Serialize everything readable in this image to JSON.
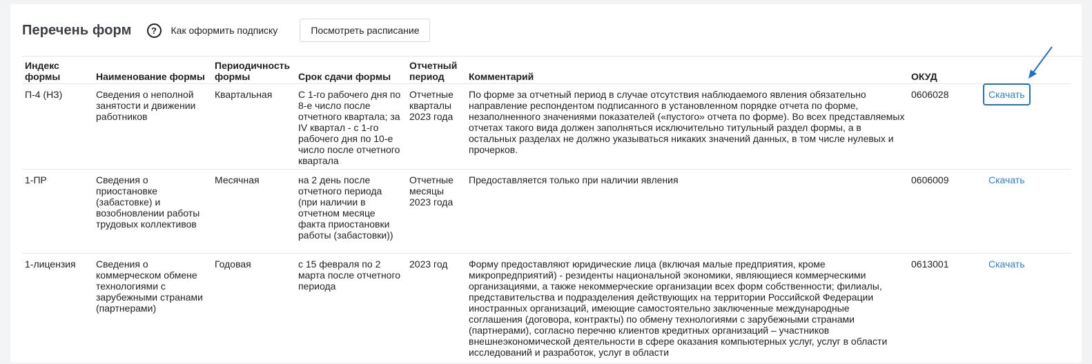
{
  "header": {
    "title": "Перечень форм",
    "help_link": "Как оформить подписку",
    "schedule_button": "Посмотреть расписание"
  },
  "table": {
    "columns": [
      "Индекс формы",
      "Наименование формы",
      "Периодичность формы",
      "Срок сдачи формы",
      "Отчетный период",
      "Комментарий",
      "ОКУД",
      ""
    ],
    "rows": [
      {
        "index": "П-4 (НЗ)",
        "name": "Сведения о неполной занятости и движении работников",
        "periodicity": "Квартальная",
        "deadline": "С 1-го рабочего дня по 8-е число после отчетного квартала; за IV квартал - с 1-го рабочего дня по 10-е число после отчетного квартала",
        "report_period": "Отчетные кварталы 2023 года",
        "comment": "По форме за отчетный период в случае отсутствия наблюдаемого явления обязательно направление респондентом подписанного в установленном порядке отчета по форме, незаполненного значениями показателей («пустого» отчета по форме). Во всех представляемых отчетах такого вида должен заполняться исключительно титульный раздел формы, а в остальных разделах не должно указываться никаких значений данных, в том числе нулевых и прочерков.",
        "okud": "0606028",
        "download": "Скачать"
      },
      {
        "index": "1-ПР",
        "name": "Сведения о приостановке (забастовке) и возобновлении работы трудовых коллективов",
        "periodicity": "Месячная",
        "deadline": "на 2 день после отчетного периода (при наличии в отчетном месяце факта приостановки работы (забастовки))",
        "report_period": "Отчетные месяцы 2023 года",
        "comment": "Предоставляется только при наличии явления",
        "okud": "0606009",
        "download": "Скачать"
      },
      {
        "index": "1-лицензия",
        "name": "Сведения о коммерческом обмене технологиями с зарубежными странами (партнерами)",
        "periodicity": "Годовая",
        "deadline": "с 15 февраля по 2 марта после отчетного периода",
        "report_period": "2023 год",
        "comment": "Форму предоставляют юридические лица (включая малые предприятия, кроме микропредприятий) - резиденты национальной экономики, являющиеся коммерческими организациями, а также некоммерческие организации всех форм собственности; филиалы, представительства и подразделения действующих на территории Российской Федерации иностранных организаций, имеющие самостоятельно заключенные международные соглашения (договора, контракты) по обмену технологиями с зарубежными странами (партнерами), согласно перечню клиентов кредитных организаций – участников внешнеэкономической деятельности в сфере оказания компьютерных услуг, услуг в области исследований и разработок, услуг в области",
        "okud": "0613001",
        "download": "Скачать"
      }
    ]
  },
  "colors": {
    "link": "#2f7dd7",
    "highlight": "#1f6fcb",
    "text": "#1f1f1f"
  },
  "icons": [
    "question-circle-icon",
    "annotation-arrow-icon"
  ]
}
